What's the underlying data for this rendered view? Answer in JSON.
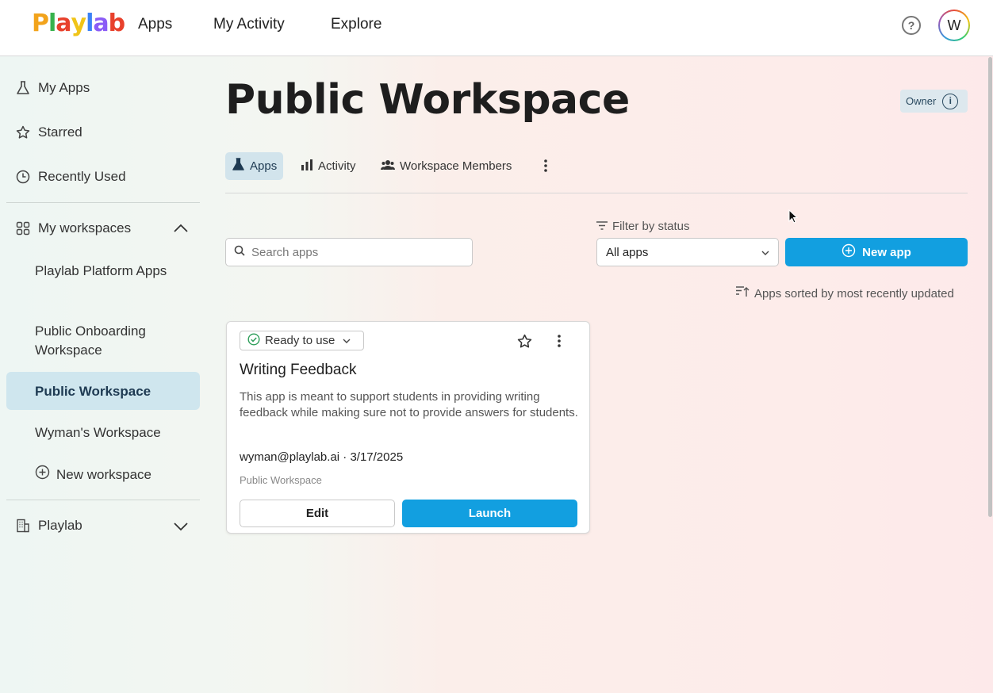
{
  "header": {
    "logo_letters": [
      "P",
      "l",
      "a",
      "y",
      "l",
      "a",
      "b"
    ],
    "logo_colors": [
      "#f2a31b",
      "#37b24d",
      "#e8412c",
      "#f0c419",
      "#3b82f6",
      "#8b5cf6",
      "#e8412c"
    ],
    "nav": [
      "Apps",
      "My Activity",
      "Explore"
    ],
    "help_icon": "question-circle-icon",
    "avatar_initial": "W"
  },
  "sidebar": {
    "items": [
      {
        "label": "My Apps",
        "icon": "flask-icon"
      },
      {
        "label": "Starred",
        "icon": "star-icon"
      },
      {
        "label": "Recently Used",
        "icon": "clock-icon"
      }
    ],
    "workspaces_label": "My workspaces",
    "workspaces_icon": "grid-icon",
    "workspaces": [
      "Playlab Platform Apps",
      "Public Onboarding Workspace",
      "Public Workspace",
      "Wyman's Workspace"
    ],
    "active_workspace": "Public Workspace",
    "new_workspace": "New workspace",
    "org_label": "Playlab",
    "org_icon": "building-icon"
  },
  "main": {
    "title": "Public Workspace",
    "role_badge": "Owner",
    "tabs": [
      {
        "label": "Apps",
        "icon": "flask-icon",
        "active": true
      },
      {
        "label": "Activity",
        "icon": "bar-chart-icon",
        "active": false
      },
      {
        "label": "Workspace Members",
        "icon": "people-icon",
        "active": false
      }
    ],
    "search_placeholder": "Search apps",
    "filter_label": "Filter by status",
    "filter_value": "All apps",
    "new_app_label": "New app",
    "sort_note": "Apps sorted by most recently updated"
  },
  "card": {
    "status": "Ready to use",
    "title": "Writing Feedback",
    "description": "This app is meant to support students in providing writing feedback while making sure not to provide answers for students.",
    "meta": "wyman@playlab.ai · 3/17/2025",
    "workspace": "Public Workspace",
    "edit_label": "Edit",
    "launch_label": "Launch"
  },
  "colors": {
    "accent": "#129fe0",
    "active_bg": "#d2e4ec",
    "ready_green": "#2e9e5a"
  }
}
